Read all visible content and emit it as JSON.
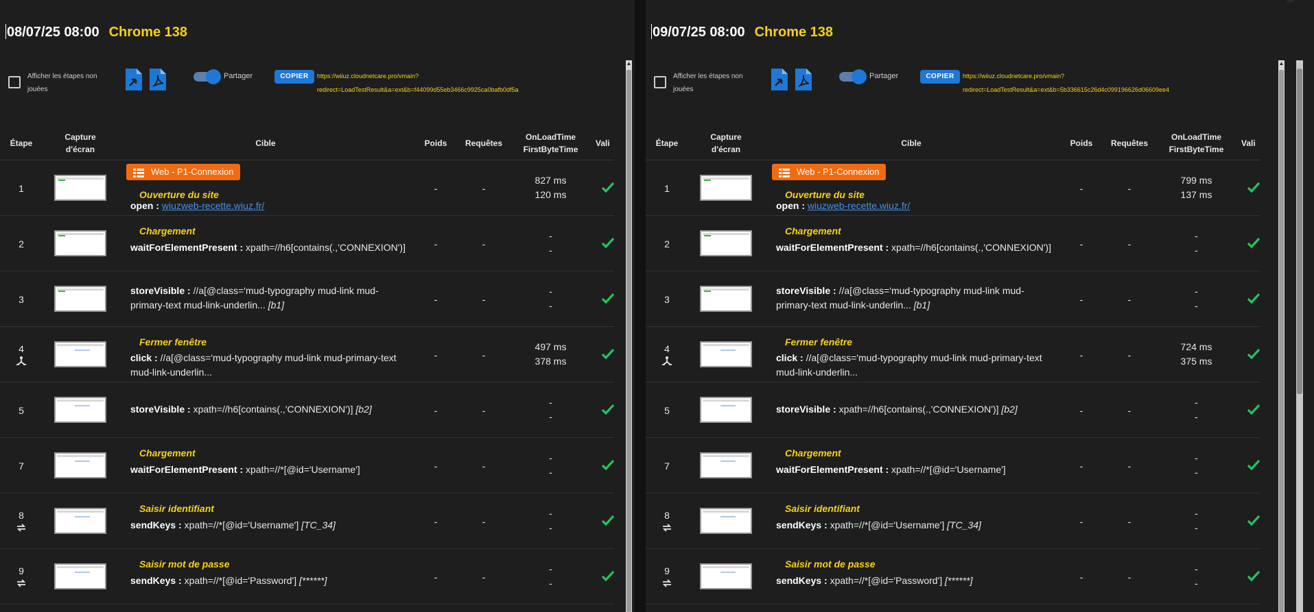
{
  "panels": [
    {
      "date": "08/07/25 08:00",
      "browser": "Chrome 138",
      "toolbar": {
        "show_unplayed_label": "Afficher les étapes non jouées",
        "share_label": "Partager",
        "copy_label": "COPIER",
        "url_line1": "https://wiiuz.cloudnetcare.pro/vmain?",
        "url_line2": "redirect=LoadTestResult&a=ext&b=f44099d55eb3466c9925ca0bafb0df5a"
      },
      "columns": {
        "step": "Étape",
        "screenshot_1": "Capture",
        "screenshot_2": "d'écran",
        "target": "Cible",
        "weight": "Poids",
        "requests": "Requêtes",
        "onload": "OnLoadTime",
        "firstbyte": "FirstByteTime",
        "valid": "Vali"
      },
      "rows": [
        {
          "step": "1",
          "icon": "",
          "badge": "Web - P1-Connexion",
          "title": "Ouverture du site",
          "cmd": "open :",
          "arg": "",
          "link": "wiuzweb-recette.wiuz.fr/",
          "suffix": "",
          "poids": "-",
          "req": "-",
          "t1": "827 ms",
          "t2": "120 ms"
        },
        {
          "step": "2",
          "icon": "",
          "badge": "",
          "title": "Chargement",
          "cmd": "waitForElementPresent :",
          "arg": "xpath=//h6[contains(.,'CONNEXION')]",
          "link": "",
          "suffix": "",
          "poids": "-",
          "req": "-",
          "t1": "-",
          "t2": "-"
        },
        {
          "step": "3",
          "icon": "",
          "badge": "",
          "title": "",
          "cmd": "storeVisible :",
          "arg": "//a[@class='mud-typography mud-link mud-primary-text mud-link-underlin...",
          "link": "",
          "suffix": "[b1]",
          "poids": "-",
          "req": "-",
          "t1": "-",
          "t2": "-"
        },
        {
          "step": "4",
          "icon": "tree",
          "badge": "",
          "title": "Fermer fenêtre",
          "cmd": "click :",
          "arg": "//a[@class='mud-typography mud-link mud-primary-text mud-link-underlin...",
          "link": "",
          "suffix": "",
          "poids": "-",
          "req": "-",
          "t1": "497 ms",
          "t2": "378 ms"
        },
        {
          "step": "5",
          "icon": "",
          "badge": "",
          "title": "",
          "cmd": "storeVisible :",
          "arg": "xpath=//h6[contains(.,'CONNEXION')]",
          "link": "",
          "suffix": "[b2]",
          "poids": "-",
          "req": "-",
          "t1": "-",
          "t2": "-"
        },
        {
          "step": "7",
          "icon": "",
          "badge": "",
          "title": "Chargement",
          "cmd": "waitForElementPresent :",
          "arg": "xpath=//*[@id='Username']",
          "link": "",
          "suffix": "",
          "poids": "-",
          "req": "-",
          "t1": "-",
          "t2": "-"
        },
        {
          "step": "8",
          "icon": "swap",
          "badge": "",
          "title": "Saisir identifiant",
          "cmd": "sendKeys :",
          "arg": "xpath=//*[@id='Username']",
          "link": "",
          "suffix": "[TC_34]",
          "poids": "-",
          "req": "-",
          "t1": "-",
          "t2": "-"
        },
        {
          "step": "9",
          "icon": "swap",
          "badge": "",
          "title": "Saisir mot de passe",
          "cmd": "sendKeys :",
          "arg": "xpath=//*[@id='Password']",
          "link": "",
          "suffix": "[******]",
          "poids": "-",
          "req": "-",
          "t1": "-",
          "t2": "-"
        }
      ]
    },
    {
      "date": "09/07/25 08:00",
      "browser": "Chrome 138",
      "toolbar": {
        "show_unplayed_label": "Afficher les étapes non jouées",
        "share_label": "Partager",
        "copy_label": "COPIER",
        "url_line1": "https://wiiuz.cloudnetcare.pro/vmain?",
        "url_line2": "redirect=LoadTestResult&a=ext&b=5b336615c26d4c099196626d06609ee4"
      },
      "columns": {
        "step": "Étape",
        "screenshot_1": "Capture",
        "screenshot_2": "d'écran",
        "target": "Cible",
        "weight": "Poids",
        "requests": "Requêtes",
        "onload": "OnLoadTime",
        "firstbyte": "FirstByteTime",
        "valid": "Vali"
      },
      "rows": [
        {
          "step": "1",
          "icon": "",
          "badge": "Web - P1-Connexion",
          "title": "Ouverture du site",
          "cmd": "open :",
          "arg": "",
          "link": "wiuzweb-recette.wiuz.fr/",
          "suffix": "",
          "poids": "-",
          "req": "-",
          "t1": "799 ms",
          "t2": "137 ms"
        },
        {
          "step": "2",
          "icon": "",
          "badge": "",
          "title": "Chargement",
          "cmd": "waitForElementPresent :",
          "arg": "xpath=//h6[contains(.,'CONNEXION')]",
          "link": "",
          "suffix": "",
          "poids": "-",
          "req": "-",
          "t1": "-",
          "t2": "-"
        },
        {
          "step": "3",
          "icon": "",
          "badge": "",
          "title": "",
          "cmd": "storeVisible :",
          "arg": "//a[@class='mud-typography mud-link mud-primary-text mud-link-underlin...",
          "link": "",
          "suffix": "[b1]",
          "poids": "-",
          "req": "-",
          "t1": "-",
          "t2": "-"
        },
        {
          "step": "4",
          "icon": "tree",
          "badge": "",
          "title": "Fermer fenêtre",
          "cmd": "click :",
          "arg": "//a[@class='mud-typography mud-link mud-primary-text mud-link-underlin...",
          "link": "",
          "suffix": "",
          "poids": "-",
          "req": "-",
          "t1": "724 ms",
          "t2": "375 ms"
        },
        {
          "step": "5",
          "icon": "",
          "badge": "",
          "title": "",
          "cmd": "storeVisible :",
          "arg": "xpath=//h6[contains(.,'CONNEXION')]",
          "link": "",
          "suffix": "[b2]",
          "poids": "-",
          "req": "-",
          "t1": "-",
          "t2": "-"
        },
        {
          "step": "7",
          "icon": "",
          "badge": "",
          "title": "Chargement",
          "cmd": "waitForElementPresent :",
          "arg": "xpath=//*[@id='Username']",
          "link": "",
          "suffix": "",
          "poids": "-",
          "req": "-",
          "t1": "-",
          "t2": "-"
        },
        {
          "step": "8",
          "icon": "swap",
          "badge": "",
          "title": "Saisir identifiant",
          "cmd": "sendKeys :",
          "arg": "xpath=//*[@id='Username']",
          "link": "",
          "suffix": "[TC_34]",
          "poids": "-",
          "req": "-",
          "t1": "-",
          "t2": "-"
        },
        {
          "step": "9",
          "icon": "swap",
          "badge": "",
          "title": "Saisir mot de passe",
          "cmd": "sendKeys :",
          "arg": "xpath=//*[@id='Password']",
          "link": "",
          "suffix": "[******]",
          "poids": "-",
          "req": "-",
          "t1": "-",
          "t2": "-"
        }
      ]
    }
  ],
  "icons": {
    "file_export": "file-export-icon",
    "pdf": "pdf-icon",
    "valid": "check-icon",
    "tree": "sitemap-icon",
    "swap": "swap-icon",
    "badge": "table-icon"
  },
  "colors": {
    "accent_blue": "#1f78d6",
    "title_yellow": "#f5d21b",
    "badge_orange": "#f26b11",
    "valid_green": "#22c55e",
    "background": "#1e1e1e"
  }
}
